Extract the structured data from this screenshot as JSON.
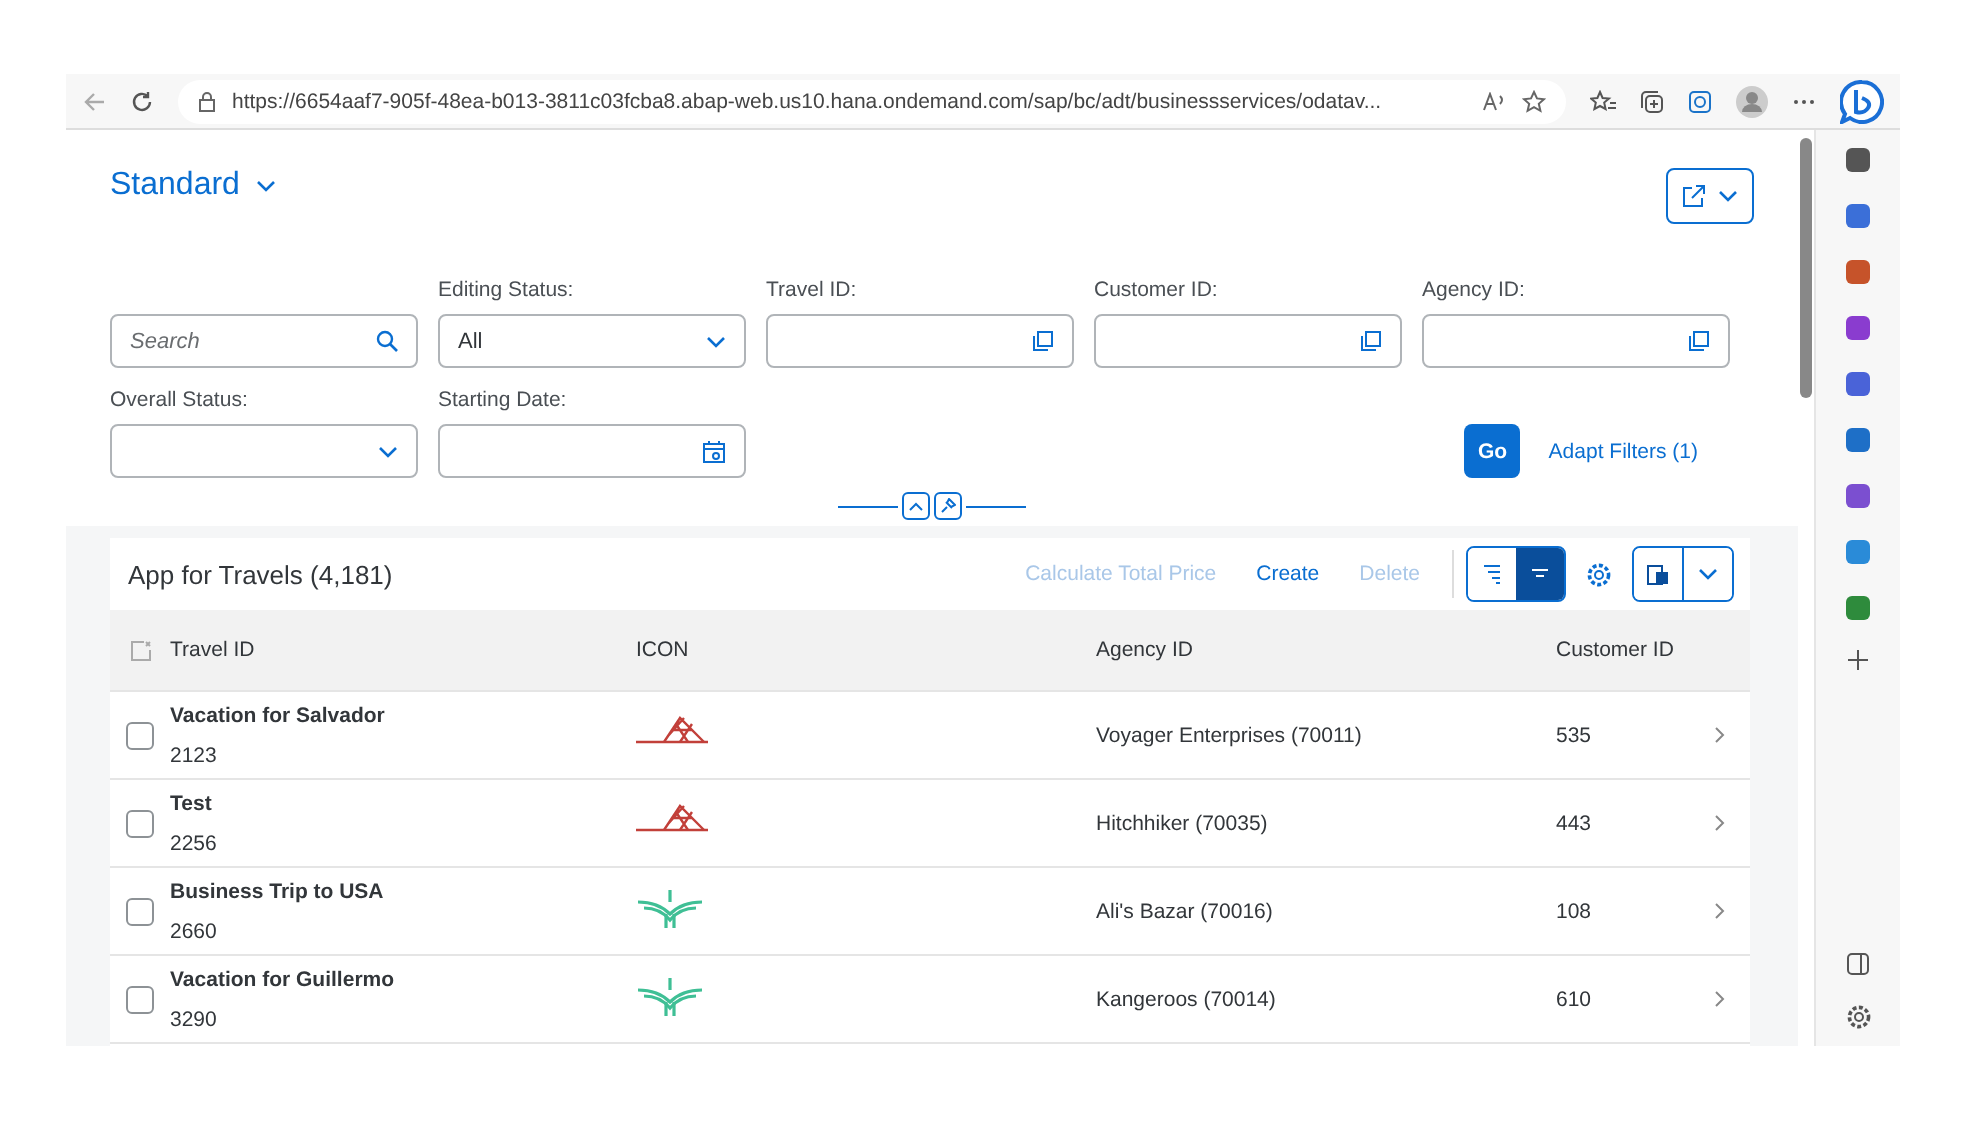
{
  "browser": {
    "url": "https://6654aaf7-905f-48ea-b013-3811c03fcba8.abap-web.us10.hana.ondemand.com/sap/bc/adt/businessservices/odatav..."
  },
  "header": {
    "variant": "Standard"
  },
  "filters": [
    {
      "kind": "search",
      "placeholder": "Search"
    },
    {
      "kind": "select",
      "label": "Editing Status:",
      "value": "All"
    },
    {
      "kind": "valuehelp",
      "label": "Travel ID:"
    },
    {
      "kind": "valuehelp",
      "label": "Customer ID:"
    },
    {
      "kind": "valuehelp",
      "label": "Agency ID:"
    },
    {
      "kind": "select",
      "label": "Overall Status:"
    },
    {
      "kind": "date",
      "label": "Starting Date:"
    }
  ],
  "filter_actions": {
    "go": "Go",
    "adapt": "Adapt Filters (1)"
  },
  "table": {
    "title": "App for Travels (4,181)",
    "actions": [
      {
        "label": "Calculate Total Price",
        "disabled": true
      },
      {
        "label": "Create",
        "disabled": false
      },
      {
        "label": "Delete",
        "disabled": true
      }
    ],
    "columns": [
      "Travel ID",
      "ICON",
      "Agency ID",
      "Customer ID"
    ],
    "rows": [
      {
        "name": "Vacation for Salvador",
        "id": "2123",
        "kind": "bridge",
        "agency": "Voyager Enterprises (70011)",
        "customer": "535",
        "checked": false
      },
      {
        "name": "Test",
        "id": "2256",
        "kind": "bridge",
        "agency": "Hitchhiker (70035)",
        "customer": "443",
        "checked": false
      },
      {
        "name": "Business Trip to USA",
        "id": "2660",
        "kind": "bird",
        "agency": "Ali's Bazar (70016)",
        "customer": "108",
        "checked": false
      },
      {
        "name": "Vacation for Guillermo",
        "id": "3290",
        "kind": "bird",
        "agency": "Kangeroos (70014)",
        "customer": "610",
        "checked": false
      }
    ]
  }
}
